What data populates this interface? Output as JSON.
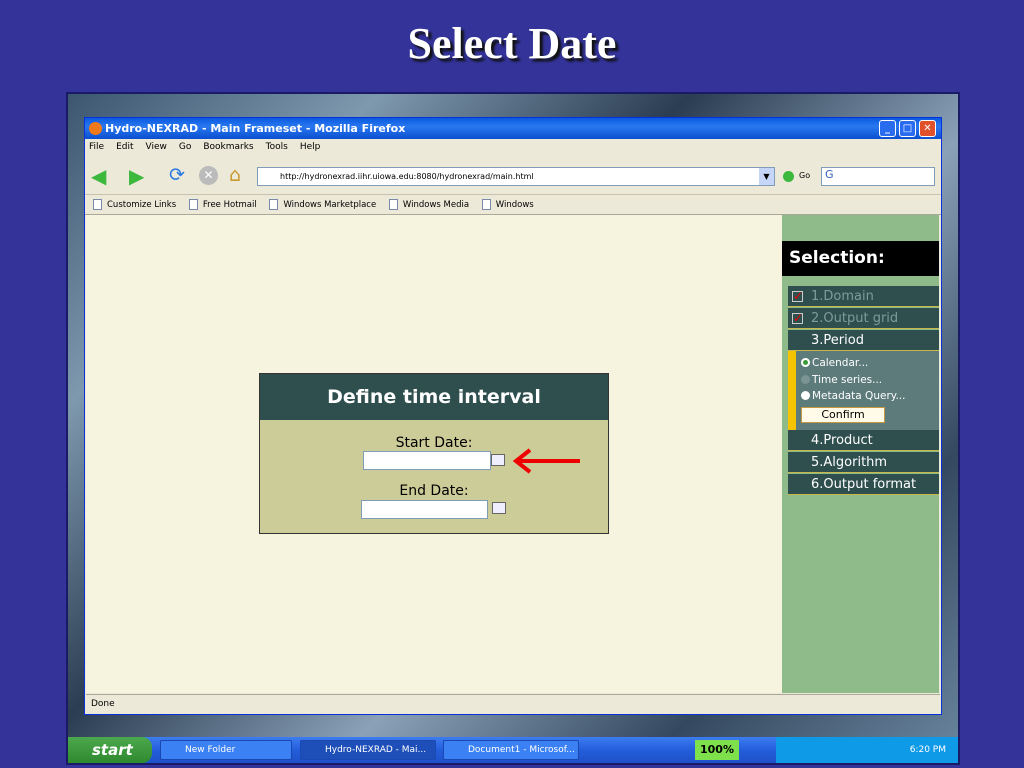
{
  "slide_title": "Select Date",
  "browser": {
    "title": "Hydro-NEXRAD - Main Frameset - Mozilla Firefox",
    "menu": [
      "File",
      "Edit",
      "View",
      "Go",
      "Bookmarks",
      "Tools",
      "Help"
    ],
    "url": "http://hydronexrad.iihr.uiowa.edu:8080/hydronexrad/main.html",
    "go_label": "Go",
    "bookmarks": [
      "Customize Links",
      "Free Hotmail",
      "Windows Marketplace",
      "Windows Media",
      "Windows"
    ],
    "status": "Done"
  },
  "selection": {
    "header": "Selection:",
    "items": [
      "1.Domain",
      "2.Output grid",
      "3.Period",
      "4.Product",
      "5.Algorithm",
      "6.Output format"
    ],
    "period_options": [
      "Calendar...",
      "Time series...",
      "Metadata Query..."
    ],
    "confirm": "Confirm"
  },
  "dialog": {
    "title": "Define time interval",
    "start_label": "Start Date:",
    "end_label": "End Date:",
    "start_value": "",
    "end_value": ""
  },
  "taskbar": {
    "start": "start",
    "items": [
      "New Folder",
      "Hydro-NEXRAD - Mai...",
      "Document1 - Microsof..."
    ],
    "zoom": "100%",
    "clock": "6:20 PM"
  }
}
